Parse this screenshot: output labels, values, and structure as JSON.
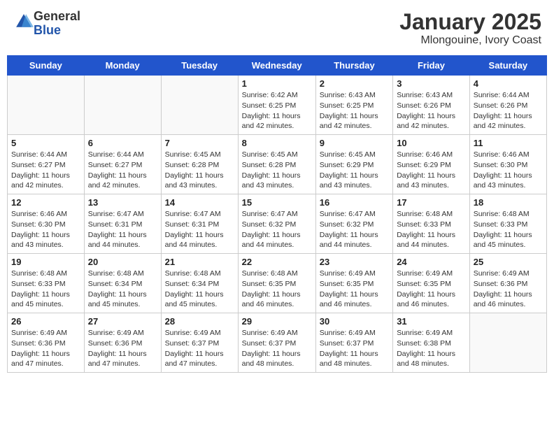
{
  "header": {
    "logo_line1": "General",
    "logo_line2": "Blue",
    "title": "January 2025",
    "subtitle": "Mlongouine, Ivory Coast"
  },
  "days_of_week": [
    "Sunday",
    "Monday",
    "Tuesday",
    "Wednesday",
    "Thursday",
    "Friday",
    "Saturday"
  ],
  "weeks": [
    [
      {
        "day": "",
        "info": ""
      },
      {
        "day": "",
        "info": ""
      },
      {
        "day": "",
        "info": ""
      },
      {
        "day": "1",
        "info": "Sunrise: 6:42 AM\nSunset: 6:25 PM\nDaylight: 11 hours and 42 minutes."
      },
      {
        "day": "2",
        "info": "Sunrise: 6:43 AM\nSunset: 6:25 PM\nDaylight: 11 hours and 42 minutes."
      },
      {
        "day": "3",
        "info": "Sunrise: 6:43 AM\nSunset: 6:26 PM\nDaylight: 11 hours and 42 minutes."
      },
      {
        "day": "4",
        "info": "Sunrise: 6:44 AM\nSunset: 6:26 PM\nDaylight: 11 hours and 42 minutes."
      }
    ],
    [
      {
        "day": "5",
        "info": "Sunrise: 6:44 AM\nSunset: 6:27 PM\nDaylight: 11 hours and 42 minutes."
      },
      {
        "day": "6",
        "info": "Sunrise: 6:44 AM\nSunset: 6:27 PM\nDaylight: 11 hours and 42 minutes."
      },
      {
        "day": "7",
        "info": "Sunrise: 6:45 AM\nSunset: 6:28 PM\nDaylight: 11 hours and 43 minutes."
      },
      {
        "day": "8",
        "info": "Sunrise: 6:45 AM\nSunset: 6:28 PM\nDaylight: 11 hours and 43 minutes."
      },
      {
        "day": "9",
        "info": "Sunrise: 6:45 AM\nSunset: 6:29 PM\nDaylight: 11 hours and 43 minutes."
      },
      {
        "day": "10",
        "info": "Sunrise: 6:46 AM\nSunset: 6:29 PM\nDaylight: 11 hours and 43 minutes."
      },
      {
        "day": "11",
        "info": "Sunrise: 6:46 AM\nSunset: 6:30 PM\nDaylight: 11 hours and 43 minutes."
      }
    ],
    [
      {
        "day": "12",
        "info": "Sunrise: 6:46 AM\nSunset: 6:30 PM\nDaylight: 11 hours and 43 minutes."
      },
      {
        "day": "13",
        "info": "Sunrise: 6:47 AM\nSunset: 6:31 PM\nDaylight: 11 hours and 44 minutes."
      },
      {
        "day": "14",
        "info": "Sunrise: 6:47 AM\nSunset: 6:31 PM\nDaylight: 11 hours and 44 minutes."
      },
      {
        "day": "15",
        "info": "Sunrise: 6:47 AM\nSunset: 6:32 PM\nDaylight: 11 hours and 44 minutes."
      },
      {
        "day": "16",
        "info": "Sunrise: 6:47 AM\nSunset: 6:32 PM\nDaylight: 11 hours and 44 minutes."
      },
      {
        "day": "17",
        "info": "Sunrise: 6:48 AM\nSunset: 6:33 PM\nDaylight: 11 hours and 44 minutes."
      },
      {
        "day": "18",
        "info": "Sunrise: 6:48 AM\nSunset: 6:33 PM\nDaylight: 11 hours and 45 minutes."
      }
    ],
    [
      {
        "day": "19",
        "info": "Sunrise: 6:48 AM\nSunset: 6:33 PM\nDaylight: 11 hours and 45 minutes."
      },
      {
        "day": "20",
        "info": "Sunrise: 6:48 AM\nSunset: 6:34 PM\nDaylight: 11 hours and 45 minutes."
      },
      {
        "day": "21",
        "info": "Sunrise: 6:48 AM\nSunset: 6:34 PM\nDaylight: 11 hours and 45 minutes."
      },
      {
        "day": "22",
        "info": "Sunrise: 6:48 AM\nSunset: 6:35 PM\nDaylight: 11 hours and 46 minutes."
      },
      {
        "day": "23",
        "info": "Sunrise: 6:49 AM\nSunset: 6:35 PM\nDaylight: 11 hours and 46 minutes."
      },
      {
        "day": "24",
        "info": "Sunrise: 6:49 AM\nSunset: 6:35 PM\nDaylight: 11 hours and 46 minutes."
      },
      {
        "day": "25",
        "info": "Sunrise: 6:49 AM\nSunset: 6:36 PM\nDaylight: 11 hours and 46 minutes."
      }
    ],
    [
      {
        "day": "26",
        "info": "Sunrise: 6:49 AM\nSunset: 6:36 PM\nDaylight: 11 hours and 47 minutes."
      },
      {
        "day": "27",
        "info": "Sunrise: 6:49 AM\nSunset: 6:36 PM\nDaylight: 11 hours and 47 minutes."
      },
      {
        "day": "28",
        "info": "Sunrise: 6:49 AM\nSunset: 6:37 PM\nDaylight: 11 hours and 47 minutes."
      },
      {
        "day": "29",
        "info": "Sunrise: 6:49 AM\nSunset: 6:37 PM\nDaylight: 11 hours and 48 minutes."
      },
      {
        "day": "30",
        "info": "Sunrise: 6:49 AM\nSunset: 6:37 PM\nDaylight: 11 hours and 48 minutes."
      },
      {
        "day": "31",
        "info": "Sunrise: 6:49 AM\nSunset: 6:38 PM\nDaylight: 11 hours and 48 minutes."
      },
      {
        "day": "",
        "info": ""
      }
    ]
  ]
}
